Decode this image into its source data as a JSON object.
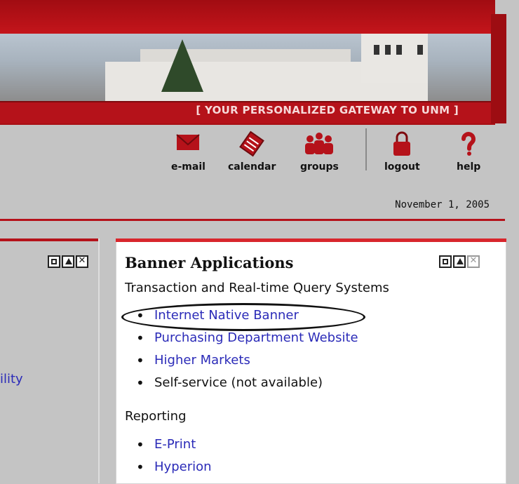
{
  "header": {
    "tagline": "[ YOUR PERSONALIZED GATEWAY TO UNM ]"
  },
  "toolbar": {
    "items": [
      {
        "label": "e-mail",
        "icon": "envelope-icon"
      },
      {
        "label": "calendar",
        "icon": "calendar-icon"
      },
      {
        "label": "groups",
        "icon": "people-icon"
      },
      {
        "label": "logout",
        "icon": "padlock-icon"
      },
      {
        "label": "help",
        "icon": "question-icon"
      }
    ]
  },
  "date": "November 1, 2005",
  "left_panel": {
    "link_fragment": "ility",
    "controls": [
      "maximize",
      "minimize",
      "close"
    ]
  },
  "banner_panel": {
    "title": "Banner Applications",
    "section1": {
      "title": "Transaction and Real-time Query Systems",
      "items": [
        {
          "label": "Internet Native Banner",
          "link": true
        },
        {
          "label": "Purchasing Department Website",
          "link": true
        },
        {
          "label": "Higher Markets",
          "link": true
        },
        {
          "label": "Self-service (not available)",
          "link": false
        }
      ]
    },
    "section2": {
      "title": "Reporting",
      "items": [
        {
          "label": "E-Print",
          "link": true
        },
        {
          "label": "Hyperion",
          "link": true
        }
      ]
    }
  },
  "colors": {
    "brand_red": "#b5121a",
    "link_blue": "#2b2bb8",
    "background_gray": "#c4c4c4"
  }
}
